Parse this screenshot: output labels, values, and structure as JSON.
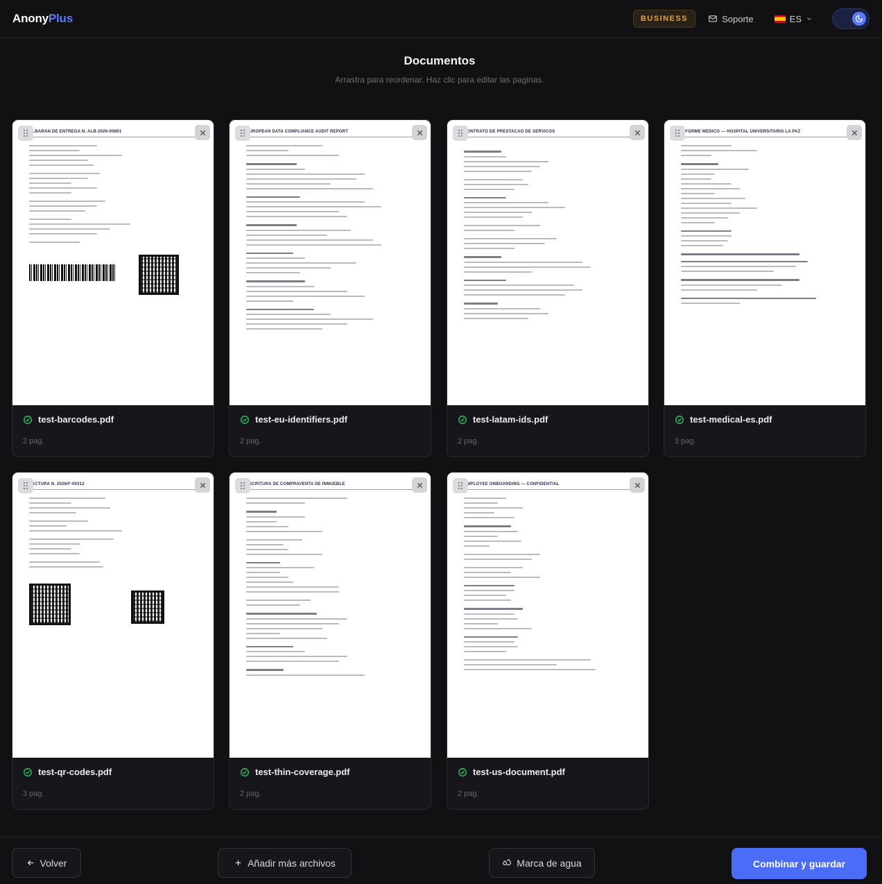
{
  "header": {
    "logo_part1": "Anony",
    "logo_part2": "Plus",
    "plan_badge": "BUSINESS",
    "support_label": "Soporte",
    "language": "ES"
  },
  "main": {
    "title": "Documentos",
    "subtitle": "Arrastra para reordenar. Haz clic para editar las paginas."
  },
  "documents": [
    {
      "filename": "test-barcodes.pdf",
      "pages": "2 pag.",
      "preview_title": "ALBARAN DE ENTREGA N. ALB-2026-00891"
    },
    {
      "filename": "test-eu-identifiers.pdf",
      "pages": "2 pag.",
      "preview_title": "EUROPEAN DATA COMPLIANCE AUDIT REPORT"
    },
    {
      "filename": "test-latam-ids.pdf",
      "pages": "2 pag.",
      "preview_title": "CONTRATO DE PRESTACAO DE SERVICOS"
    },
    {
      "filename": "test-medical-es.pdf",
      "pages": "3 pag.",
      "preview_title": "INFORME MEDICO — HOSPITAL UNIVERSITARIO LA PAZ"
    },
    {
      "filename": "test-qr-codes.pdf",
      "pages": "3 pag.",
      "preview_title": "FACTURA N. 2026/F-00312"
    },
    {
      "filename": "test-thin-coverage.pdf",
      "pages": "2 pag.",
      "preview_title": "ESCRITURA DE COMPRAVENTA DE INMUEBLE"
    },
    {
      "filename": "test-us-document.pdf",
      "pages": "2 pag.",
      "preview_title": "EMPLOYEE ONBOARDING — CONFIDENTIAL"
    }
  ],
  "footer": {
    "back_label": "Volver",
    "add_label": "Añadir más archivos",
    "watermark_label": "Marca de agua",
    "save_label": "Combinar y guardar"
  },
  "colors": {
    "accent": "#4a6cf7",
    "badge": "#e9a23b",
    "success": "#22c55e"
  }
}
